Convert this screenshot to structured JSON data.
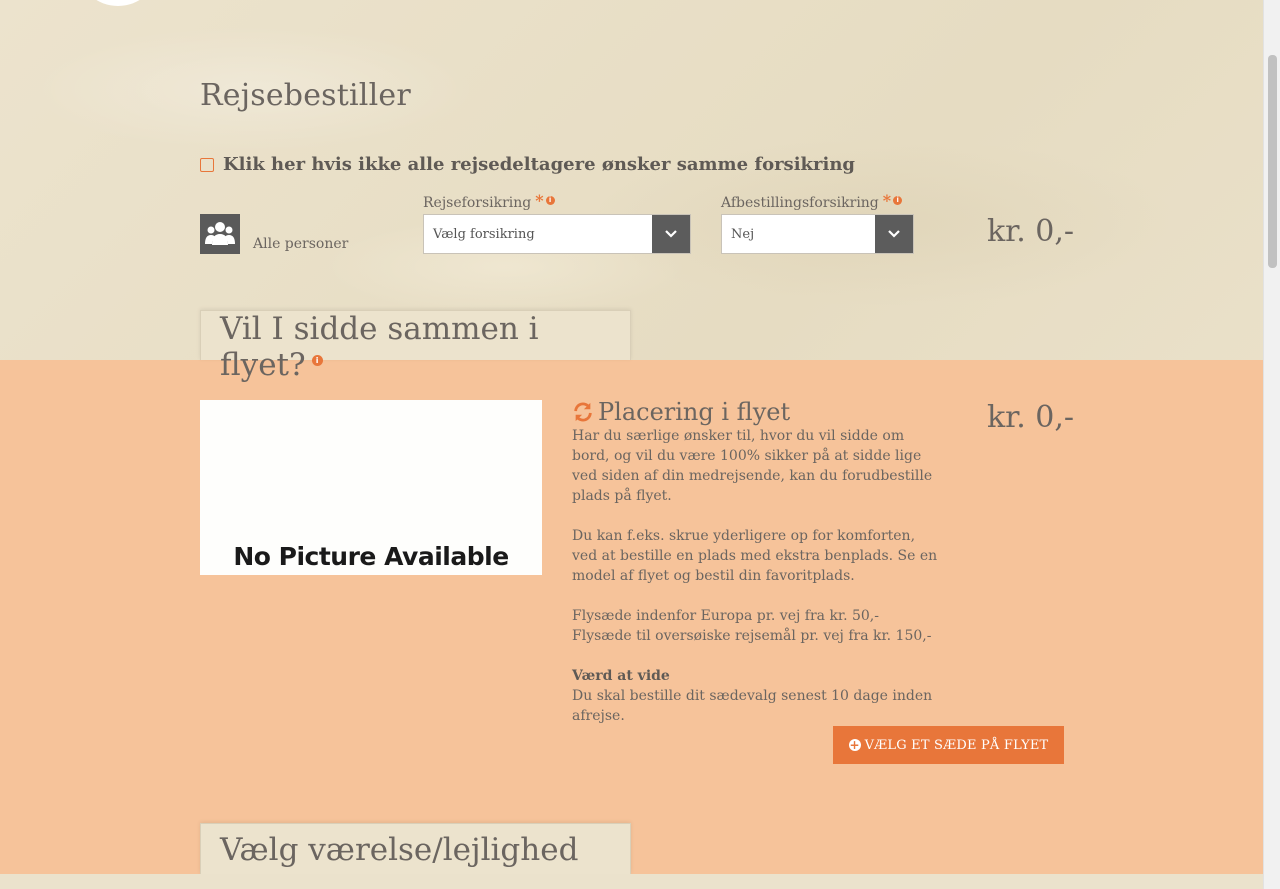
{
  "page": {
    "section_title": "Rejsebestiller",
    "checkbox_label": "Klik her hvis ikke alle rejsedeltagere ønsker samme forsikring"
  },
  "insurance": {
    "persons_label": "Alle personer",
    "travel_label": "Rejseforsikring",
    "travel_value": "Vælg forsikring",
    "cancel_label": "Afbestillingsforsikring",
    "cancel_value": "Nej",
    "required_mark": "*",
    "price": "kr. 0,-"
  },
  "seat_section": {
    "tab_title": "Vil I sidde sammen i flyet?",
    "image_text": "No Picture Available",
    "title": "Placering i flyet",
    "price": "kr. 0,-",
    "paragraph1": "Har du særlige ønsker til, hvor du vil sidde om bord, og vil du være 100% sikker på at sidde lige ved siden af din medrejsende, kan du forudbestille plads på flyet.",
    "paragraph2": "Du kan f.eks. skrue yderligere op for komforten, ved at bestille en plads med ekstra benplads. Se en model af flyet og bestil din favoritplads.",
    "paragraph3": "Flysæde indenfor Europa pr. vej fra kr. 50,- Flysæde til oversøiske rejsemål pr. vej fra kr. 150,-",
    "note_title": "Værd at vide",
    "note_text": "Du skal bestille dit sædevalg senest 10 dage inden afrejse.",
    "button_label": "VÆLG ET SÆDE PÅ FLYET"
  },
  "room_section": {
    "tab_title": "Vælg værelse/lejlighed"
  },
  "colors": {
    "accent": "#e8763a",
    "band": "#f6c39a",
    "sand": "#e9dfc8",
    "dark_button": "#5c5c5c"
  }
}
